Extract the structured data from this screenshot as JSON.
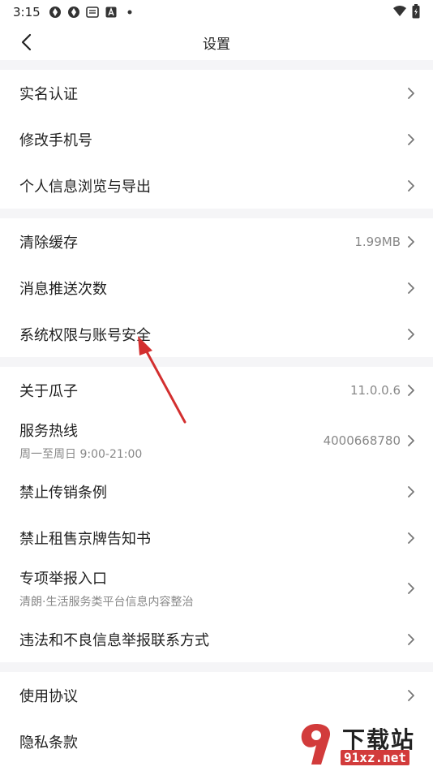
{
  "status_bar": {
    "time": "3:15",
    "icons": [
      "app-icon-1",
      "app-icon-2",
      "message-icon",
      "a-icon",
      "dot-icon"
    ],
    "right_icons": [
      "wifi-icon",
      "battery-icon"
    ]
  },
  "header": {
    "title": "设置"
  },
  "sections": [
    {
      "items": [
        {
          "label": "实名认证"
        },
        {
          "label": "修改手机号"
        },
        {
          "label": "个人信息浏览与导出"
        }
      ]
    },
    {
      "items": [
        {
          "label": "清除缓存",
          "value": "1.99MB"
        },
        {
          "label": "消息推送次数"
        },
        {
          "label": "系统权限与账号安全"
        }
      ]
    },
    {
      "items": [
        {
          "label": "关于瓜子",
          "value": "11.0.0.6"
        },
        {
          "label": "服务热线",
          "sub": "周一至周日 9:00-21:00",
          "value": "4000668780"
        },
        {
          "label": "禁止传销条例"
        },
        {
          "label": "禁止租售京牌告知书"
        },
        {
          "label": "专项举报入口",
          "sub": "清朗·生活服务类平台信息内容整治"
        },
        {
          "label": "违法和不良信息举报联系方式"
        }
      ]
    },
    {
      "items": [
        {
          "label": "使用协议"
        },
        {
          "label": "隐私条款"
        }
      ]
    }
  ],
  "watermark": {
    "text": "下载站",
    "url": "91xz.net"
  },
  "colors": {
    "accent_arrow": "#d32f2f",
    "separator": "#f5f5f7",
    "secondary_text": "#888888"
  }
}
